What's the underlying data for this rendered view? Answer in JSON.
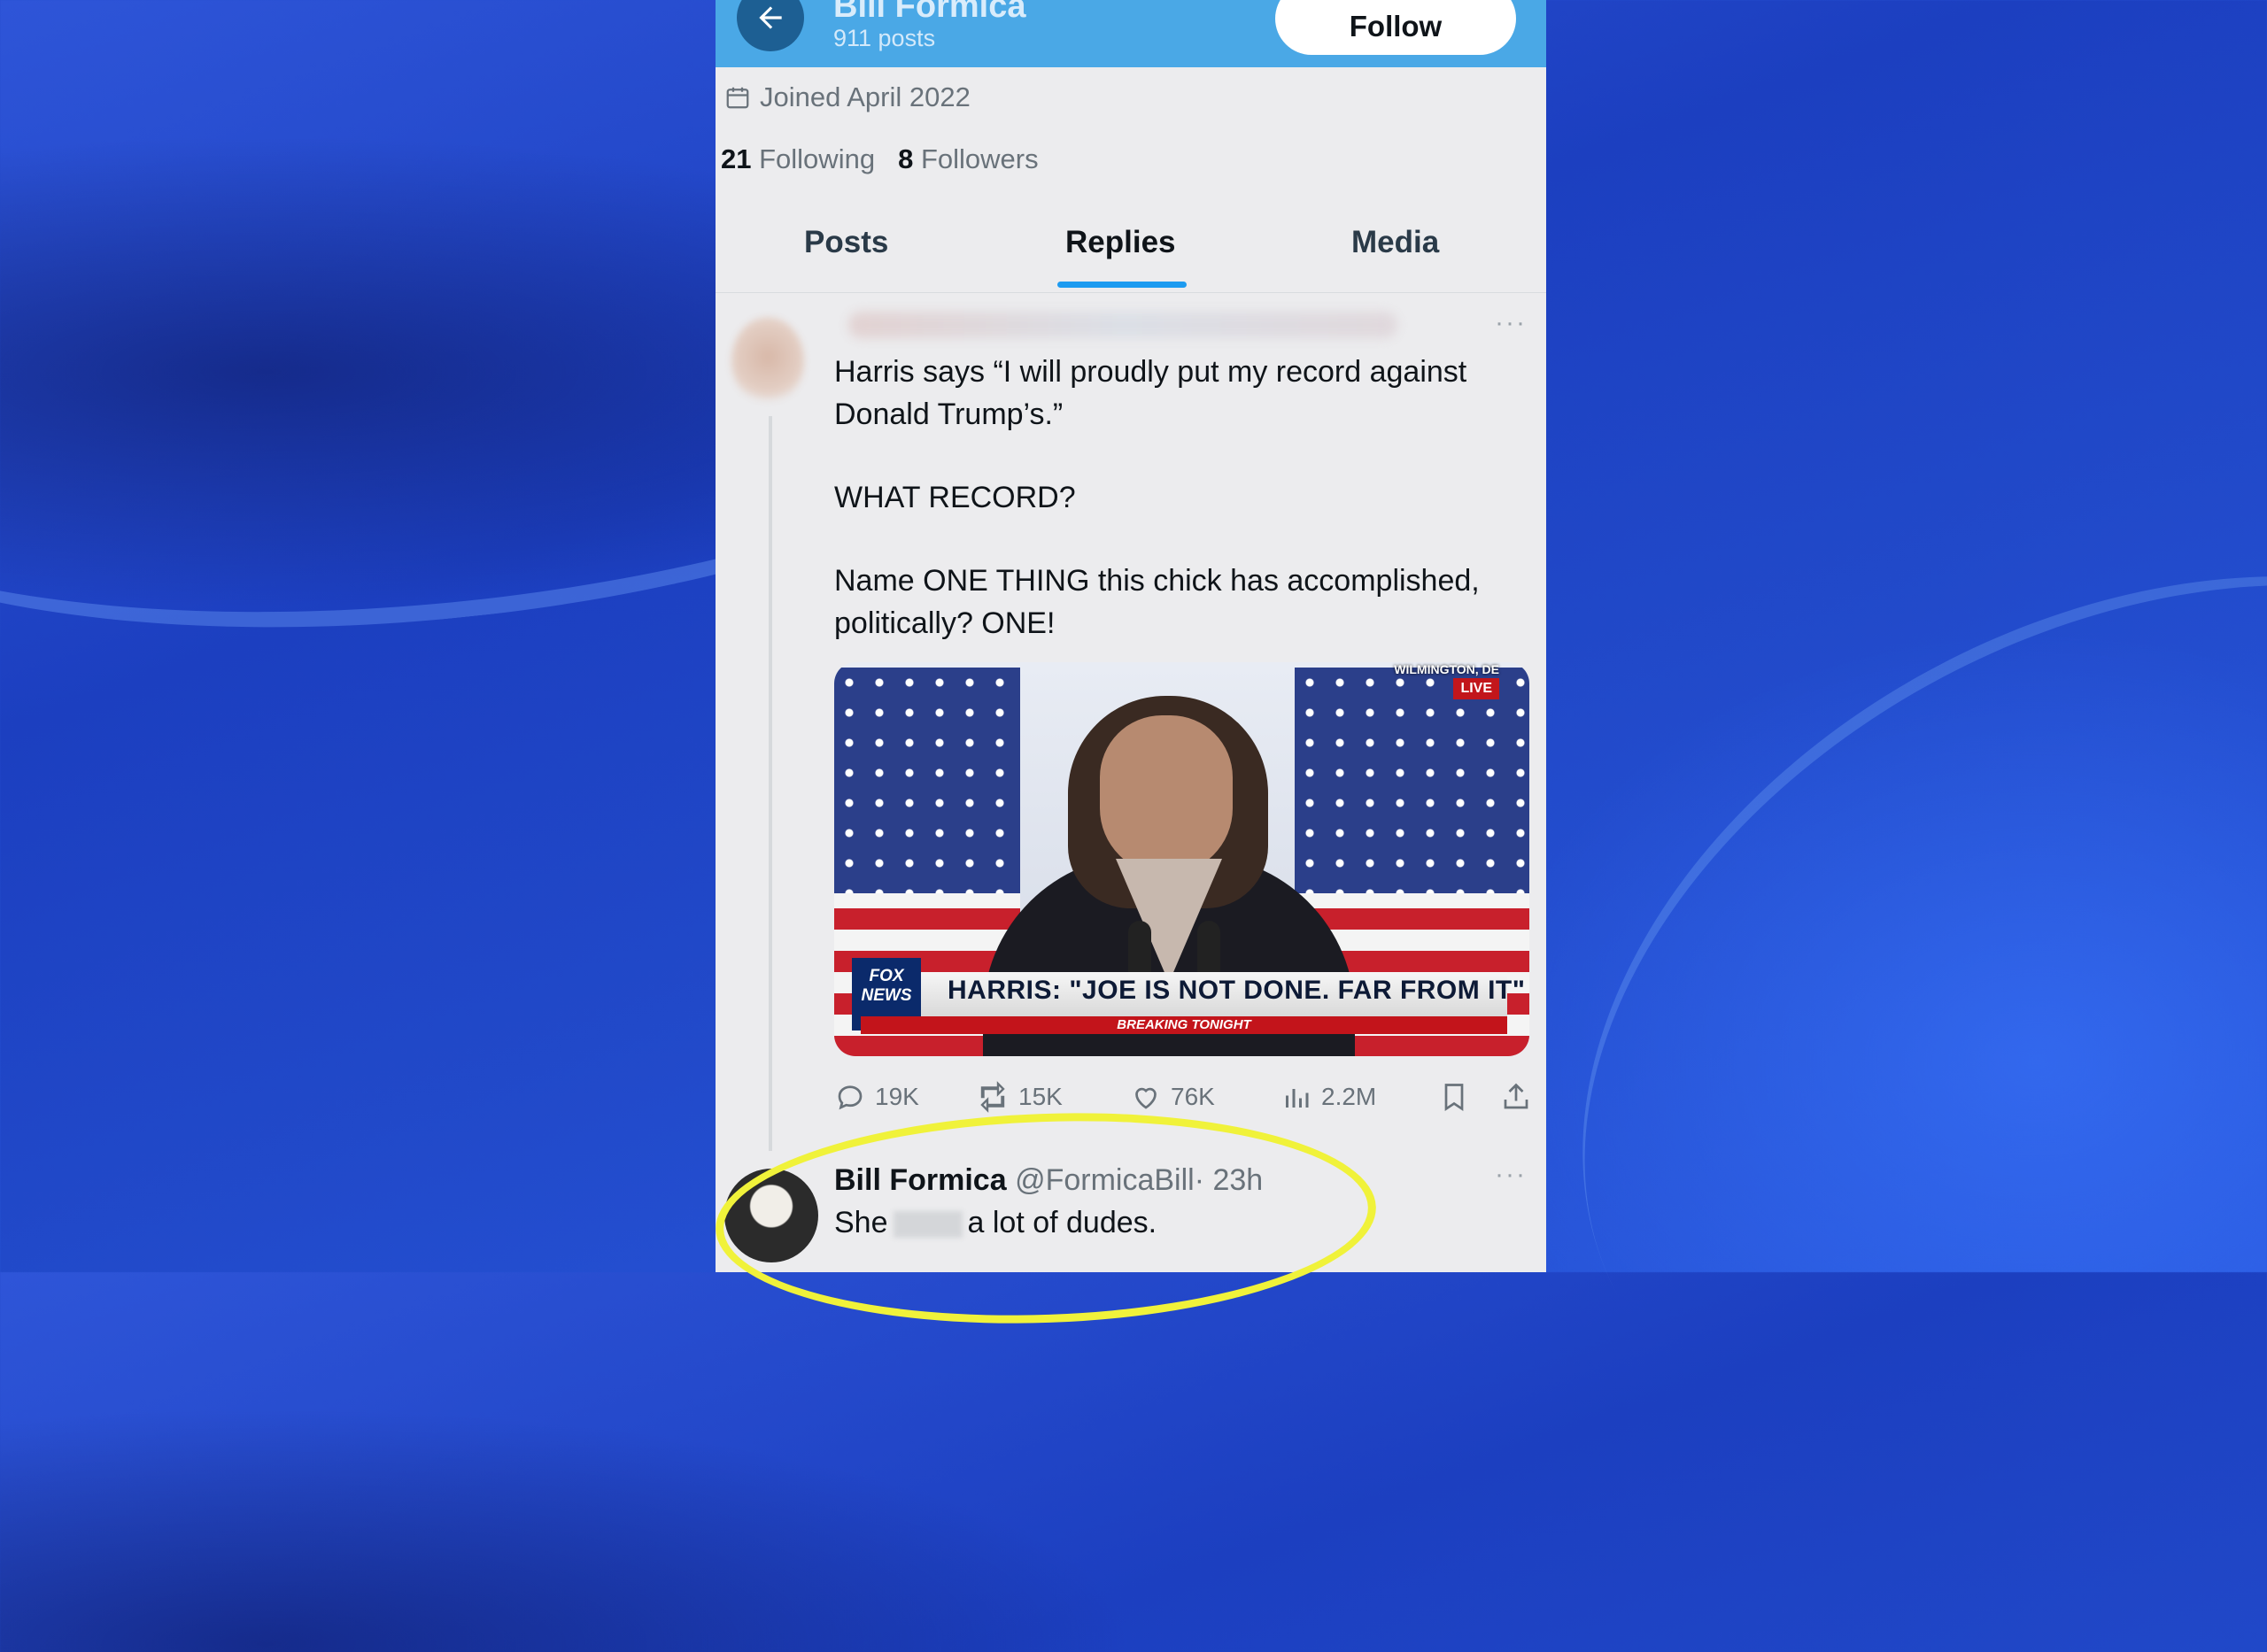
{
  "header": {
    "display_name": "Bill Formica",
    "post_count": "911 posts",
    "follow_label": "Follow"
  },
  "profile": {
    "joined": "Joined April 2022",
    "following_count": "21",
    "following_label": "Following",
    "followers_count": "8",
    "followers_label": "Followers"
  },
  "tabs": [
    {
      "label": "Posts",
      "active": false
    },
    {
      "label": "Replies",
      "active": true
    },
    {
      "label": "Media",
      "active": false
    }
  ],
  "original_post": {
    "text": [
      "Harris says “I will proudly put my record against Donald Trump’s.”",
      "WHAT RECORD?",
      "Name ONE THING this chick has accomplished, politically? ONE!"
    ],
    "media": {
      "chyron": "HARRIS: \"JOE IS NOT DONE. FAR FROM IT\"",
      "chyron_sub": "BREAKING TONIGHT",
      "network": "FOX NEWS",
      "location": "WILMINGTON, DE",
      "live": "LIVE"
    },
    "stats": {
      "replies": "19K",
      "reposts": "15K",
      "likes": "76K",
      "views": "2.2M"
    }
  },
  "reply": {
    "name": "Bill Formica",
    "handle": "@FormicaBill",
    "time": "· 23h",
    "text_before": "She",
    "text_after": "a lot of dudes."
  },
  "colors": {
    "header_bg": "#4aa8e6",
    "accent": "#1d9bf0",
    "highlight": "#f0f23a"
  }
}
